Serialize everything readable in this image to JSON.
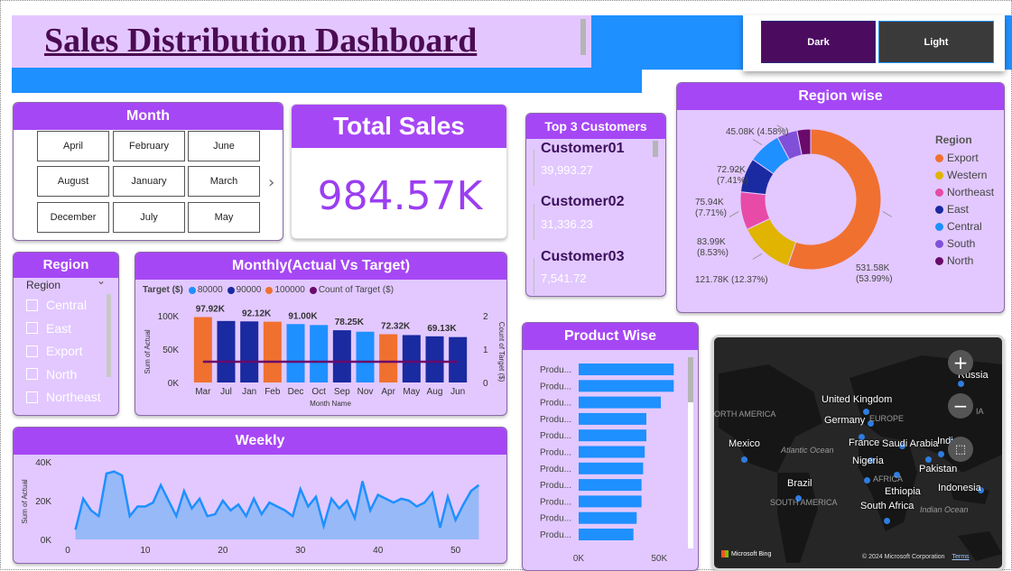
{
  "title": "Sales Distribution Dashboard",
  "theme": {
    "dark_label": "Dark",
    "light_label": "Light"
  },
  "colors": {
    "accent": "#a647f5",
    "panel": "#e2c8ff",
    "header_blue": "#1e90ff",
    "title": "#4a0b52"
  },
  "month_slicer": {
    "title": "Month",
    "months": [
      "April",
      "February",
      "June",
      "August",
      "January",
      "March",
      "December",
      "July",
      "May"
    ]
  },
  "total_sales": {
    "title": "Total Sales",
    "value": "984.57K"
  },
  "top_customers": {
    "title": "Top 3 Customers",
    "items": [
      {
        "name": "Customer01",
        "value": "39,993.27"
      },
      {
        "name": "Customer02",
        "value": "31,336.23"
      },
      {
        "name": "Customer03",
        "value": "7,541.72"
      }
    ]
  },
  "region_slicer": {
    "title": "Region",
    "dropdown_label": "Region",
    "items": [
      "Central",
      "East",
      "Export",
      "North",
      "Northeast"
    ]
  },
  "monthly": {
    "title": "Monthly(Actual Vs Target)",
    "legend_title": "Target ($)",
    "legend": [
      {
        "label": "80000",
        "color": "#1e90ff"
      },
      {
        "label": "90000",
        "color": "#1a2aa0"
      },
      {
        "label": "100000",
        "color": "#f07030"
      },
      {
        "label": "Count of Target ($)",
        "color": "#6a0a6a"
      }
    ],
    "ylabel": "Sum of Actual",
    "y2label": "Count of Target ($)",
    "xlabel": "Month Name",
    "yticks": [
      "100K",
      "50K",
      "0K"
    ],
    "y2ticks": [
      "2",
      "1",
      "0"
    ]
  },
  "weekly": {
    "title": "Weekly",
    "ylabel": "Sum of Actual",
    "yticks": [
      "40K",
      "20K",
      "0K"
    ],
    "xticks": [
      "0",
      "10",
      "20",
      "30",
      "40",
      "50"
    ]
  },
  "product": {
    "title": "Product Wise",
    "bar_label": "Produ...",
    "xticks": [
      "0K",
      "50K"
    ]
  },
  "region_wise": {
    "title": "Region wise",
    "legend_title": "Region"
  },
  "map": {
    "labels": [
      "Russia",
      "United Kingdom",
      "Germany",
      "France",
      "Saudi Arabia",
      "Indi",
      "Pakistan",
      "Mexico",
      "Nigeria",
      "Brazil",
      "Ethiopia",
      "Indonesia",
      "South Africa"
    ],
    "region_labels": [
      "ORTH AMERICA",
      "EUROPE",
      "Atlantic Ocean",
      "AFRICA",
      "SOUTH AMERICA",
      "Indian Ocean",
      "IA"
    ],
    "brand": "Microsoft Bing",
    "copyright": "© 2024 Microsoft Corporation",
    "terms": "Terms"
  },
  "chart_data": [
    {
      "type": "bar",
      "title": "Monthly(Actual Vs Target)",
      "xlabel": "Month Name",
      "ylabel": "Sum of Actual",
      "categories": [
        "Mar",
        "Jul",
        "Jan",
        "Feb",
        "Dec",
        "Oct",
        "Sep",
        "Nov",
        "Apr",
        "May",
        "Aug",
        "Jun"
      ],
      "values": [
        97920,
        92120,
        91500,
        91000,
        87500,
        86000,
        78250,
        76000,
        72320,
        71000,
        69130,
        68000
      ],
      "target_colors": [
        "#f07030",
        "#1a2aa0",
        "#1a2aa0",
        "#f07030",
        "#1e90ff",
        "#1e90ff",
        "#1a2aa0",
        "#1e90ff",
        "#f07030",
        "#1a2aa0",
        "#1a2aa0",
        "#1a2aa0"
      ],
      "data_labels": [
        "97.92K",
        "",
        "92.12K",
        "",
        "91.00K",
        "",
        "78.25K",
        "",
        "72.32K",
        "",
        "69.13K",
        ""
      ],
      "line_series": {
        "name": "Count of Target ($)",
        "values": [
          1,
          1,
          1,
          1,
          1,
          1,
          1,
          1,
          1,
          1,
          1,
          1
        ]
      },
      "ylim": [
        0,
        100000
      ],
      "y2lim": [
        0,
        2
      ]
    },
    {
      "type": "area",
      "title": "Weekly",
      "ylabel": "Sum of Actual",
      "x": [
        1,
        2,
        3,
        4,
        5,
        6,
        7,
        8,
        9,
        10,
        11,
        12,
        13,
        14,
        15,
        16,
        17,
        18,
        19,
        20,
        21,
        22,
        23,
        24,
        25,
        26,
        27,
        28,
        29,
        30,
        31,
        32,
        33,
        34,
        35,
        36,
        37,
        38,
        39,
        40,
        41,
        42,
        43,
        44,
        45,
        46,
        47,
        48,
        49,
        50,
        51,
        52,
        53
      ],
      "values": [
        5000,
        21000,
        15000,
        12000,
        34000,
        35000,
        33000,
        12000,
        17000,
        17000,
        19000,
        28000,
        20000,
        12000,
        25000,
        16000,
        21000,
        12000,
        13000,
        20000,
        15000,
        18000,
        12000,
        21000,
        13000,
        19000,
        17000,
        15000,
        12000,
        26000,
        17000,
        22000,
        7000,
        21000,
        16000,
        20000,
        11000,
        30000,
        15000,
        23000,
        21000,
        19000,
        21000,
        20000,
        17000,
        19000,
        24000,
        6000,
        22000,
        10000,
        18000,
        25000,
        28000
      ],
      "xlim": [
        0,
        54
      ],
      "ylim": [
        0,
        40000
      ]
    },
    {
      "type": "bar",
      "title": "Product Wise",
      "orientation": "horizontal",
      "categories": [
        "Produ...",
        "Produ...",
        "Produ...",
        "Produ...",
        "Produ...",
        "Produ...",
        "Produ...",
        "Produ...",
        "Produ...",
        "Produ...",
        "Produ..."
      ],
      "values": [
        59000,
        59000,
        51000,
        42000,
        42000,
        41000,
        40000,
        39000,
        39000,
        36000,
        34000
      ],
      "xlim": [
        0,
        65000
      ]
    },
    {
      "type": "pie",
      "title": "Region wise",
      "donut": true,
      "categories": [
        "Export",
        "Western",
        "Northeast",
        "East",
        "Central",
        "South",
        "North"
      ],
      "values": [
        531580,
        121780,
        83990,
        75940,
        72920,
        45080,
        30000
      ],
      "colors": [
        "#f07030",
        "#e0b400",
        "#e84aa8",
        "#1a2aa0",
        "#1e90ff",
        "#8050d8",
        "#6a0a6a"
      ],
      "data_labels": [
        "531.58K (53.99%)",
        "121.78K (12.37%)",
        "83.99K (8.53%)",
        "75.94K (7.71%)",
        "72.92K (7.41%)",
        "45.08K (4.58%)",
        ""
      ]
    }
  ]
}
